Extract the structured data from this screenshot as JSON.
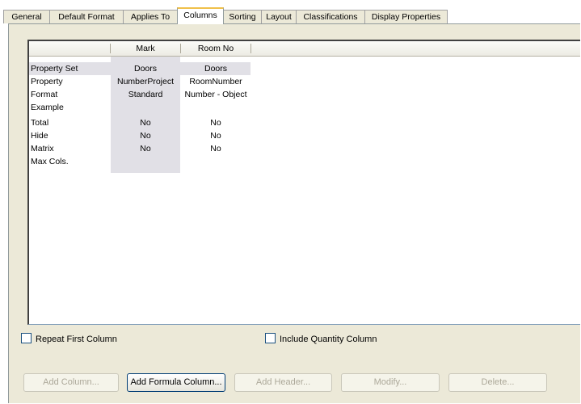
{
  "tabs": [
    {
      "label": "General"
    },
    {
      "label": "Default Format"
    },
    {
      "label": "Applies To"
    },
    {
      "label": "Columns"
    },
    {
      "label": "Sorting"
    },
    {
      "label": "Layout"
    },
    {
      "label": "Classifications"
    },
    {
      "label": "Display Properties"
    }
  ],
  "active_tab": "Columns",
  "grid": {
    "columns": [
      "Mark",
      "Room No"
    ],
    "row_labels": [
      "Property Set",
      "Property",
      "Format",
      "Example",
      "Total",
      "Hide",
      "Matrix",
      "Max Cols."
    ],
    "mark": [
      "Doors",
      "NumberProject",
      "Standard",
      "",
      "No",
      "No",
      "No",
      ""
    ],
    "room_no": [
      "Doors",
      "RoomNumber",
      "Number - Object",
      "",
      "No",
      "No",
      "No",
      ""
    ]
  },
  "options": {
    "repeat_first_column": {
      "label": "Repeat First Column",
      "checked": false
    },
    "include_quantity_column": {
      "label": "Include Quantity Column",
      "checked": false
    }
  },
  "buttons": {
    "add_column": "Add Column...",
    "add_formula_column": "Add Formula Column...",
    "add_header": "Add Header...",
    "modify": "Modify...",
    "delete": "Delete..."
  }
}
